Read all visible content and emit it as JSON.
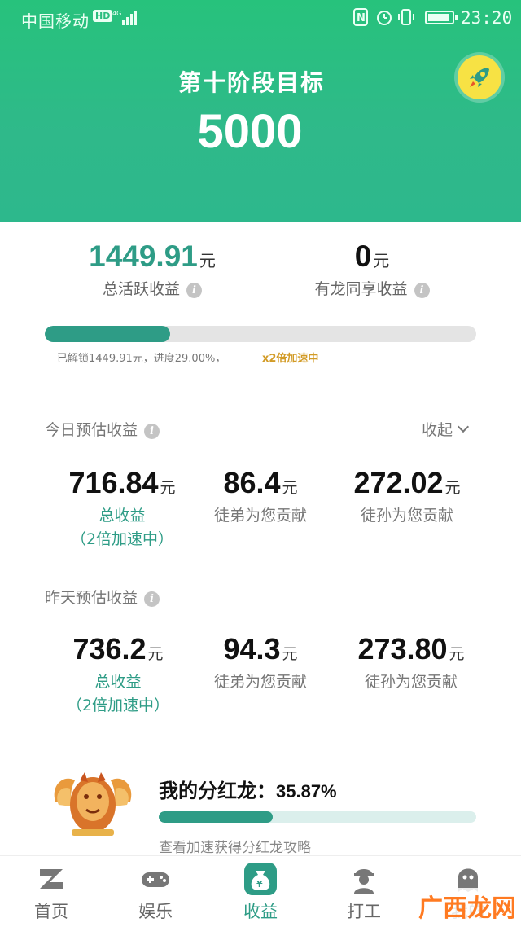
{
  "status_bar": {
    "carrier": "中国移动",
    "hd": "HD",
    "time": "23:20"
  },
  "header": {
    "stage_title": "第十阶段目标",
    "stage_target": "5000",
    "rocket_icon": "rocket-icon"
  },
  "totals": {
    "active_value": "1449.91",
    "active_unit": "元",
    "active_label": "总活跃收益",
    "shared_value": "0",
    "shared_unit": "元",
    "shared_label": "有龙同享收益",
    "progress_percent": 29.0,
    "progress_text": "已解锁1449.91元，进度29.00%，",
    "boost_text": "x2倍加速中"
  },
  "today": {
    "title": "今日预估收益",
    "collapse_label": "收起",
    "total_value": "716.84",
    "total_label": "总收益",
    "total_sub": "（2倍加速中）",
    "apprentice_value": "86.4",
    "apprentice_label": "徒弟为您贡献",
    "grand_value": "272.02",
    "grand_label": "徒孙为您贡献",
    "unit": "元"
  },
  "yesterday": {
    "title": "昨天预估收益",
    "total_value": "736.2",
    "total_label": "总收益",
    "total_sub": "（2倍加速中）",
    "apprentice_value": "94.3",
    "apprentice_label": "徒弟为您贡献",
    "grand_value": "273.80",
    "grand_label": "徒孙为您贡献",
    "unit": "元"
  },
  "dragon": {
    "title": "我的分红龙：",
    "percent_text": "35.87%",
    "percent": 35.87,
    "link": "查看加速获得分红龙攻略"
  },
  "nav": {
    "items": [
      {
        "label": "首页",
        "icon": "z-logo-icon"
      },
      {
        "label": "娱乐",
        "icon": "gamepad-icon"
      },
      {
        "label": "收益",
        "icon": "money-bag-icon"
      },
      {
        "label": "打工",
        "icon": "worker-icon"
      },
      {
        "label": "我的",
        "icon": "ghost-icon"
      }
    ]
  },
  "watermark": "广西龙网",
  "colors": {
    "header_green": "#2bbd7e",
    "accent_teal": "#2e9c86",
    "boost_gold": "#d29b26",
    "rocket_yellow": "#f7e244"
  }
}
